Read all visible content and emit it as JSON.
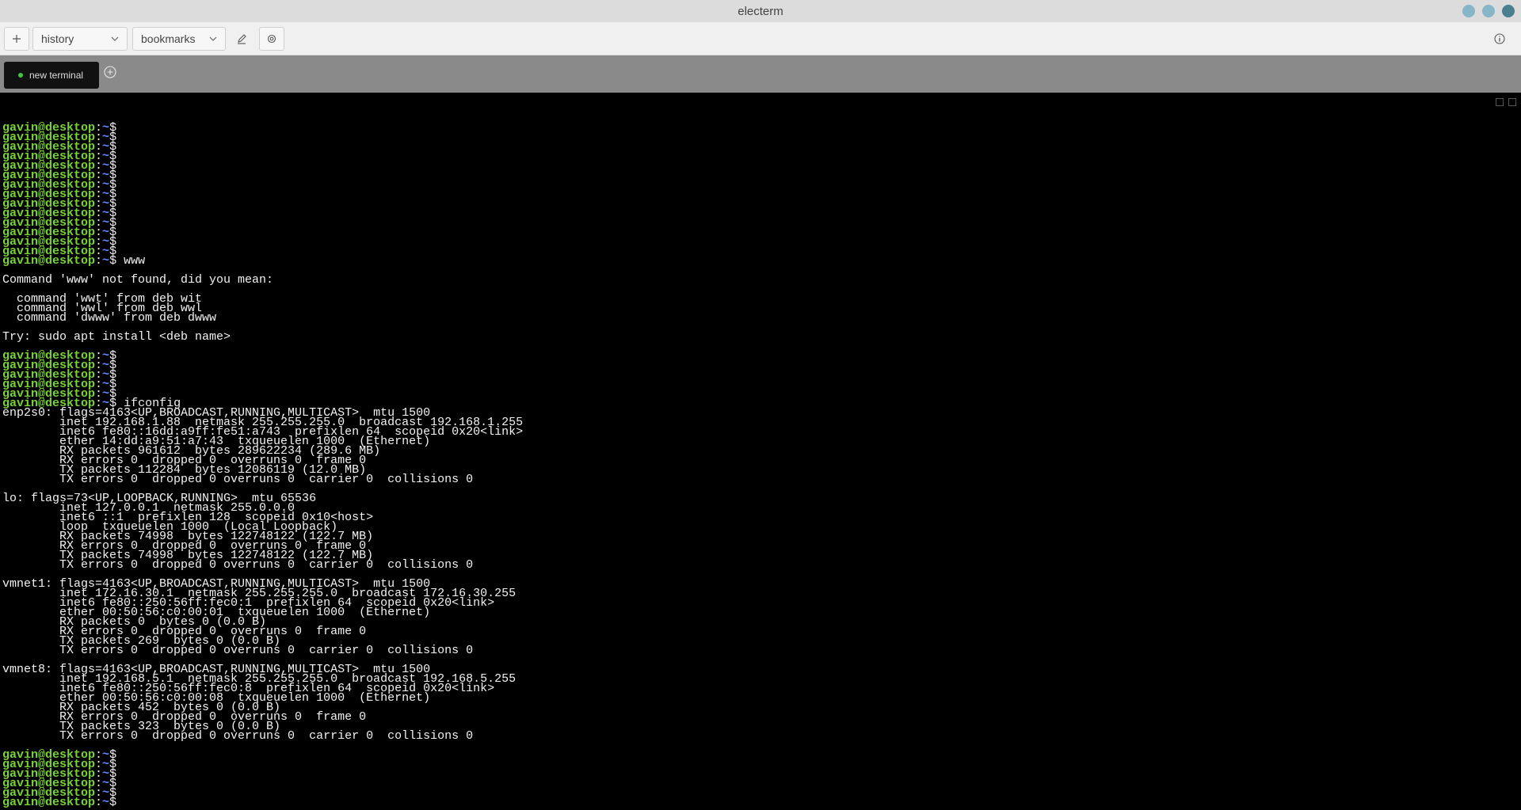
{
  "window": {
    "title": "electerm"
  },
  "toolbar": {
    "add_icon": "plus-icon",
    "history_label": "history",
    "bookmarks_label": "bookmarks",
    "edit_icon": "pencil-icon",
    "settings_icon": "gear-icon",
    "info_icon": "info-icon"
  },
  "tabs": [
    {
      "label": "new terminal",
      "status_color": "#3fc53f"
    }
  ],
  "terminal": {
    "prompt_user": "gavin@desktop",
    "prompt_path": "~",
    "lines": [
      {
        "type": "prompt",
        "cmd": ""
      },
      {
        "type": "prompt",
        "cmd": ""
      },
      {
        "type": "prompt",
        "cmd": ""
      },
      {
        "type": "prompt",
        "cmd": ""
      },
      {
        "type": "prompt",
        "cmd": ""
      },
      {
        "type": "prompt",
        "cmd": ""
      },
      {
        "type": "prompt",
        "cmd": ""
      },
      {
        "type": "prompt",
        "cmd": ""
      },
      {
        "type": "prompt",
        "cmd": ""
      },
      {
        "type": "prompt",
        "cmd": ""
      },
      {
        "type": "prompt",
        "cmd": ""
      },
      {
        "type": "prompt",
        "cmd": ""
      },
      {
        "type": "prompt",
        "cmd": ""
      },
      {
        "type": "prompt",
        "cmd": ""
      },
      {
        "type": "prompt",
        "cmd": " www"
      },
      {
        "type": "text",
        "text": ""
      },
      {
        "type": "text",
        "text": "Command 'www' not found, did you mean:"
      },
      {
        "type": "text",
        "text": ""
      },
      {
        "type": "text",
        "text": "  command 'wwt' from deb wit"
      },
      {
        "type": "text",
        "text": "  command 'wwl' from deb wwl"
      },
      {
        "type": "text",
        "text": "  command 'dwww' from deb dwww"
      },
      {
        "type": "text",
        "text": ""
      },
      {
        "type": "text",
        "text": "Try: sudo apt install <deb name>"
      },
      {
        "type": "text",
        "text": ""
      },
      {
        "type": "prompt",
        "cmd": ""
      },
      {
        "type": "prompt",
        "cmd": ""
      },
      {
        "type": "prompt",
        "cmd": ""
      },
      {
        "type": "prompt",
        "cmd": ""
      },
      {
        "type": "prompt",
        "cmd": ""
      },
      {
        "type": "prompt",
        "cmd": " ifconfig"
      },
      {
        "type": "text",
        "text": "enp2s0: flags=4163<UP,BROADCAST,RUNNING,MULTICAST>  mtu 1500"
      },
      {
        "type": "text",
        "text": "        inet 192.168.1.88  netmask 255.255.255.0  broadcast 192.168.1.255"
      },
      {
        "type": "text",
        "text": "        inet6 fe80::16dd:a9ff:fe51:a743  prefixlen 64  scopeid 0x20<link>"
      },
      {
        "type": "text",
        "text": "        ether 14:dd:a9:51:a7:43  txqueuelen 1000  (Ethernet)"
      },
      {
        "type": "text",
        "text": "        RX packets 961612  bytes 289622234 (289.6 MB)"
      },
      {
        "type": "text",
        "text": "        RX errors 0  dropped 0  overruns 0  frame 0"
      },
      {
        "type": "text",
        "text": "        TX packets 112284  bytes 12086119 (12.0 MB)"
      },
      {
        "type": "text",
        "text": "        TX errors 0  dropped 0 overruns 0  carrier 0  collisions 0"
      },
      {
        "type": "text",
        "text": ""
      },
      {
        "type": "text",
        "text": "lo: flags=73<UP,LOOPBACK,RUNNING>  mtu 65536"
      },
      {
        "type": "text",
        "text": "        inet 127.0.0.1  netmask 255.0.0.0"
      },
      {
        "type": "text",
        "text": "        inet6 ::1  prefixlen 128  scopeid 0x10<host>"
      },
      {
        "type": "text",
        "text": "        loop  txqueuelen 1000  (Local Loopback)"
      },
      {
        "type": "text",
        "text": "        RX packets 74998  bytes 122748122 (122.7 MB)"
      },
      {
        "type": "text",
        "text": "        RX errors 0  dropped 0  overruns 0  frame 0"
      },
      {
        "type": "text",
        "text": "        TX packets 74998  bytes 122748122 (122.7 MB)"
      },
      {
        "type": "text",
        "text": "        TX errors 0  dropped 0 overruns 0  carrier 0  collisions 0"
      },
      {
        "type": "text",
        "text": ""
      },
      {
        "type": "text",
        "text": "vmnet1: flags=4163<UP,BROADCAST,RUNNING,MULTICAST>  mtu 1500"
      },
      {
        "type": "text",
        "text": "        inet 172.16.30.1  netmask 255.255.255.0  broadcast 172.16.30.255"
      },
      {
        "type": "text",
        "text": "        inet6 fe80::250:56ff:fec0:1  prefixlen 64  scopeid 0x20<link>"
      },
      {
        "type": "text",
        "text": "        ether 00:50:56:c0:00:01  txqueuelen 1000  (Ethernet)"
      },
      {
        "type": "text",
        "text": "        RX packets 0  bytes 0 (0.0 B)"
      },
      {
        "type": "text",
        "text": "        RX errors 0  dropped 0  overruns 0  frame 0"
      },
      {
        "type": "text",
        "text": "        TX packets 269  bytes 0 (0.0 B)"
      },
      {
        "type": "text",
        "text": "        TX errors 0  dropped 0 overruns 0  carrier 0  collisions 0"
      },
      {
        "type": "text",
        "text": ""
      },
      {
        "type": "text",
        "text": "vmnet8: flags=4163<UP,BROADCAST,RUNNING,MULTICAST>  mtu 1500"
      },
      {
        "type": "text",
        "text": "        inet 192.168.5.1  netmask 255.255.255.0  broadcast 192.168.5.255"
      },
      {
        "type": "text",
        "text": "        inet6 fe80::250:56ff:fec0:8  prefixlen 64  scopeid 0x20<link>"
      },
      {
        "type": "text",
        "text": "        ether 00:50:56:c0:00:08  txqueuelen 1000  (Ethernet)"
      },
      {
        "type": "text",
        "text": "        RX packets 452  bytes 0 (0.0 B)"
      },
      {
        "type": "text",
        "text": "        RX errors 0  dropped 0  overruns 0  frame 0"
      },
      {
        "type": "text",
        "text": "        TX packets 323  bytes 0 (0.0 B)"
      },
      {
        "type": "text",
        "text": "        TX errors 0  dropped 0 overruns 0  carrier 0  collisions 0"
      },
      {
        "type": "text",
        "text": ""
      },
      {
        "type": "prompt",
        "cmd": ""
      },
      {
        "type": "prompt",
        "cmd": ""
      },
      {
        "type": "prompt",
        "cmd": ""
      },
      {
        "type": "prompt",
        "cmd": ""
      },
      {
        "type": "prompt",
        "cmd": ""
      },
      {
        "type": "prompt",
        "cmd": ""
      }
    ]
  }
}
